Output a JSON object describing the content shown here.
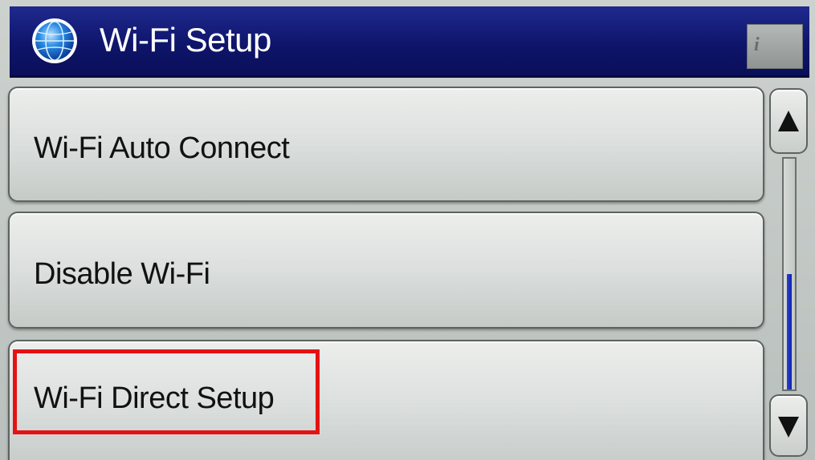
{
  "header": {
    "title": "Wi-Fi Setup",
    "globe_icon": "globe-icon",
    "info_icon": "info-icon",
    "info_glyph": "i"
  },
  "menu": {
    "items": [
      {
        "label": "Wi-Fi Auto Connect"
      },
      {
        "label": "Disable Wi-Fi"
      },
      {
        "label": "Wi-Fi Direct Setup",
        "highlighted": true
      }
    ]
  },
  "scrollbar": {
    "up_icon": "triangle-up-icon",
    "down_icon": "triangle-down-icon",
    "position_fraction": 0.5
  },
  "colors": {
    "header_blue": "#0e156b",
    "highlight_red": "#e41313",
    "scroll_blue": "#1a2fc4"
  }
}
